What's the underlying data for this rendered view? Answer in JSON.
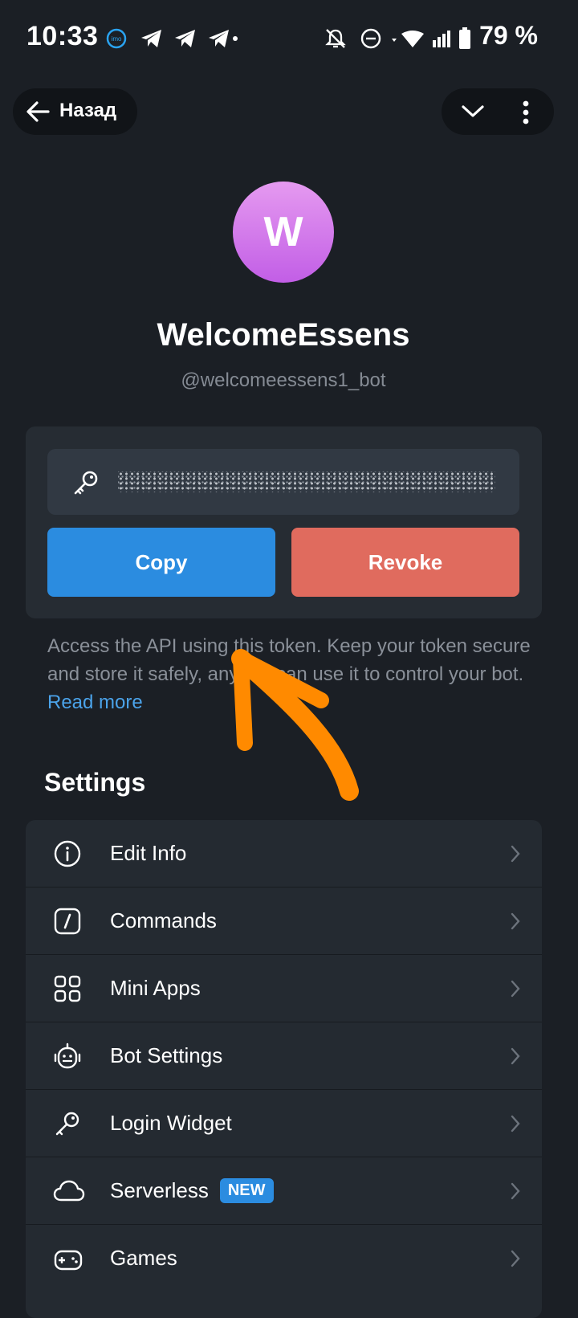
{
  "status_bar": {
    "time": "10:33",
    "notification_icons": [
      "imo-icon",
      "telegram-icon",
      "telegram-icon",
      "telegram-icon"
    ],
    "battery_percent": "79 %"
  },
  "header": {
    "back_label": "Назад"
  },
  "bot": {
    "avatar_letter": "W",
    "name": "WelcomeEssens",
    "username": "@welcomeessens1_bot"
  },
  "token": {
    "copy_label": "Copy",
    "revoke_label": "Revoke",
    "description": "Access the API using this token. Keep your token secure and store it safely, anyone can use it to control your bot.",
    "read_more": "Read more"
  },
  "settings": {
    "title": "Settings",
    "items": [
      {
        "label": "Edit Info",
        "icon": "info-icon"
      },
      {
        "label": "Commands",
        "icon": "command-icon"
      },
      {
        "label": "Mini Apps",
        "icon": "grid-icon"
      },
      {
        "label": "Bot Settings",
        "icon": "robot-icon"
      },
      {
        "label": "Login Widget",
        "icon": "key-icon"
      },
      {
        "label": "Serverless",
        "icon": "cloud-icon",
        "badge": "NEW"
      },
      {
        "label": "Games",
        "icon": "gamepad-icon"
      }
    ]
  },
  "colors": {
    "background": "#1b1f25",
    "card": "#262c33",
    "accent_blue": "#2b8ce0",
    "danger_red": "#e06b5e",
    "annotation_arrow": "#ff8a00"
  }
}
